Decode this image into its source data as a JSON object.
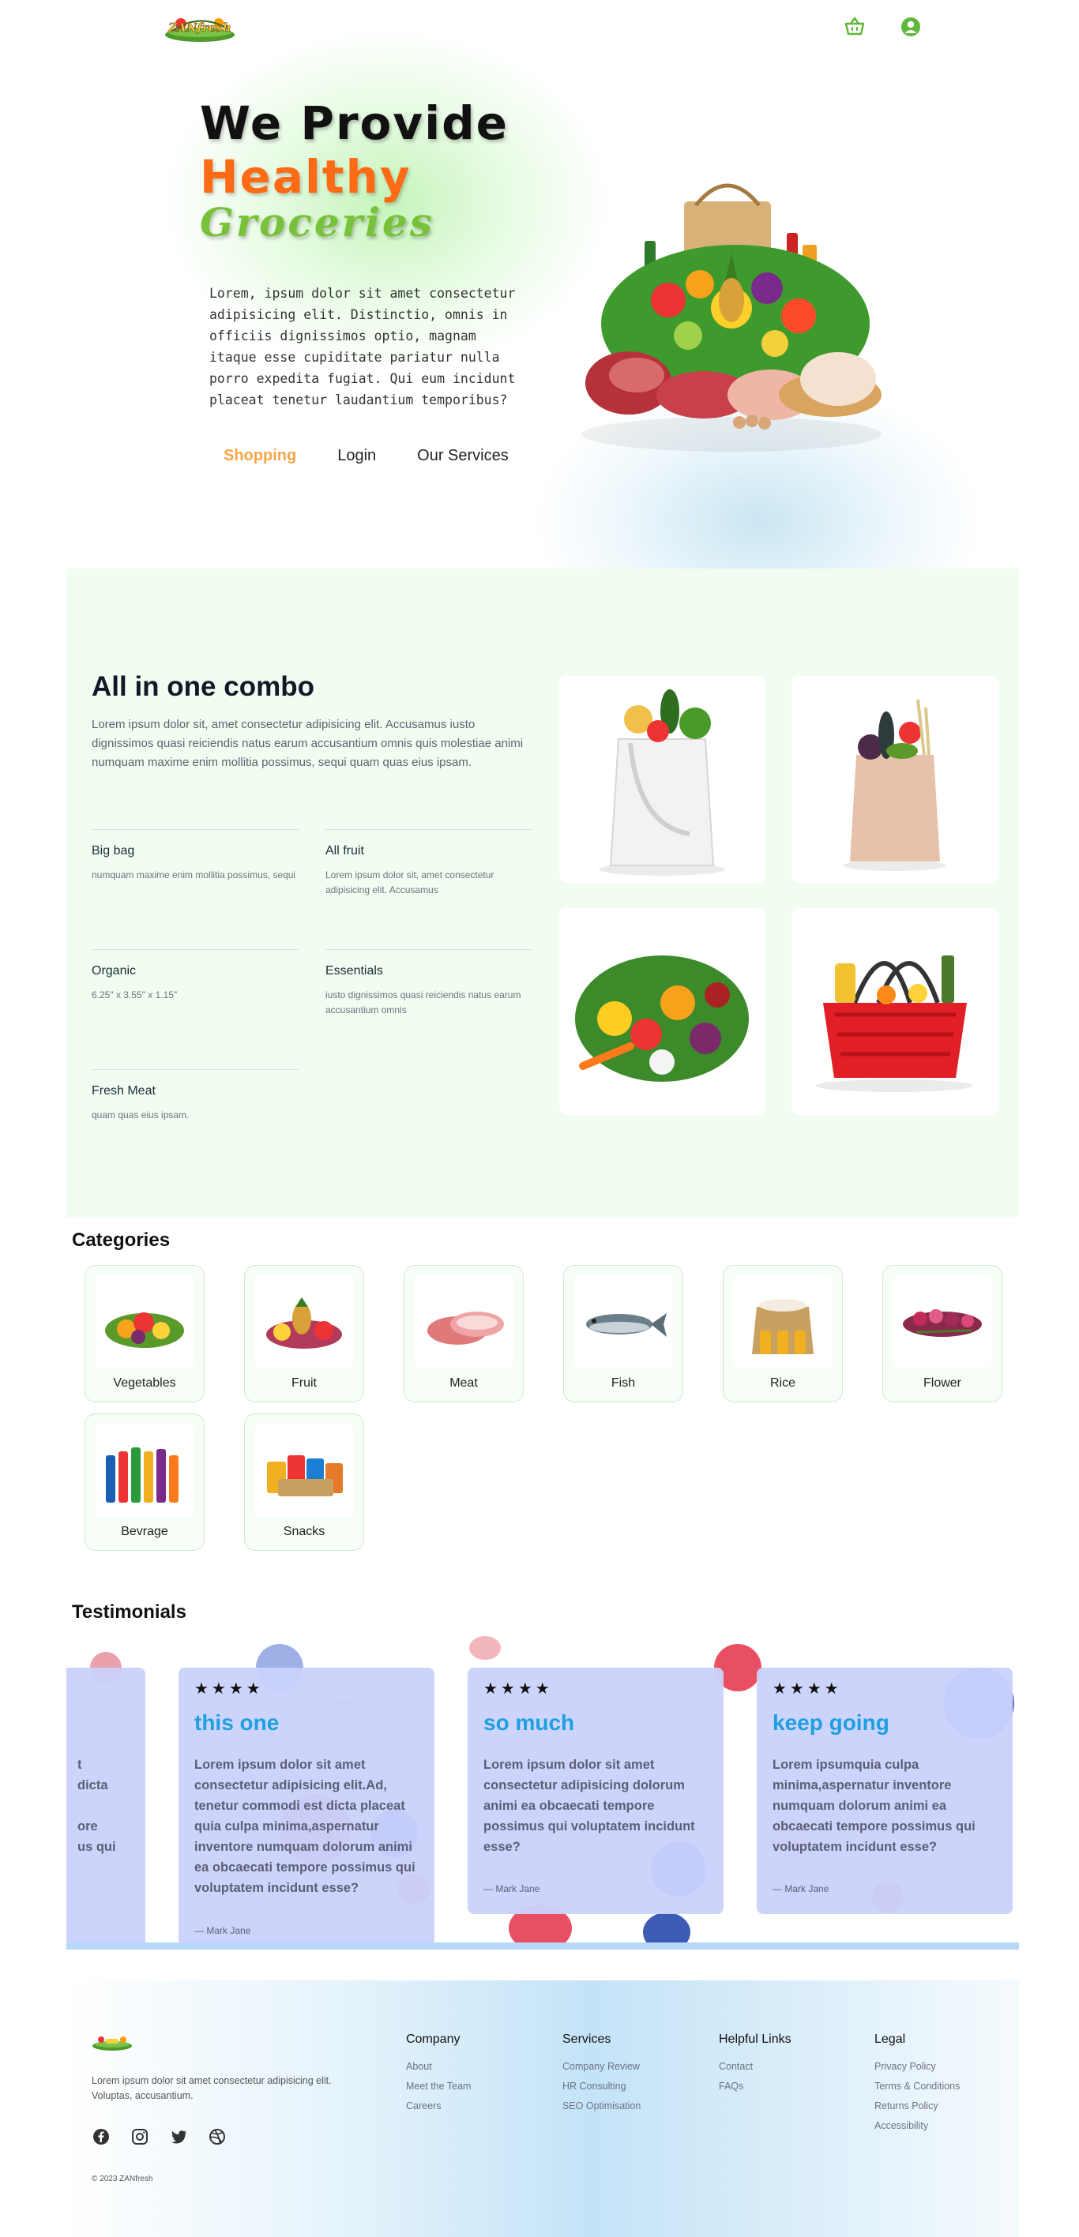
{
  "header": {
    "logo_text": "ZANfresh",
    "cart_icon": "basket-icon",
    "user_icon": "user-circle-icon",
    "accent_color": "#5fb83a"
  },
  "hero": {
    "line1": "We Provide",
    "line2": "Healthy",
    "line3": "Groceries",
    "text": "Lorem, ipsum dolor sit amet consectetur adipisicing elit. Distinctio, omnis in officiis dignissimos optio, magnam itaque esse cupiditate pariatur nulla porro expedita fugiat. Qui eum incidunt placeat tenetur laudantium temporibus?",
    "nav": [
      "Shopping",
      "Login",
      "Our Services"
    ],
    "colors": {
      "healthy": "#ff6a14",
      "groceries": "#78c23a",
      "active_nav": "#f5a64a"
    }
  },
  "combo": {
    "title": "All in one combo",
    "description": "Lorem ipsum dolor sit, amet consectetur adipisicing elit. Accusamus iusto dignissimos quasi reiciendis natus earum accusantium omnis quis molestiae animi numquam maxime enim mollitia possimus, sequi quam quas eius ipsam.",
    "features": [
      {
        "name": "Big bag",
        "text": "numquam maxime enim mollitia possimus, sequi"
      },
      {
        "name": "All fruit",
        "text": "Lorem ipsum dolor sit, amet consectetur adipisicing elit. Accusamus"
      },
      {
        "name": "Organic",
        "text": "6.25\" x 3.55\" x 1.15\""
      },
      {
        "name": "Essentials",
        "text": "iusto dignissimos quasi reiciendis natus earum accusantium omnis"
      },
      {
        "name": "Fresh Meat",
        "text": "quam quas eius ipsam."
      }
    ],
    "images": [
      "white-tote-bag-groceries",
      "paper-bag-vegetables",
      "vegetable-pile",
      "red-basket-groceries"
    ]
  },
  "categories": {
    "title": "Categories",
    "items": [
      "Vegetables",
      "Fruit",
      "Meat",
      "Fish",
      "Rice",
      "Flower",
      "Bevrage",
      "Snacks"
    ]
  },
  "testimonials": {
    "title": "Testimonials",
    "partial_card_lines": [
      "t",
      "dicta",
      "ore",
      "us qui"
    ],
    "cards": [
      {
        "stars": "★★★★",
        "title": "this one",
        "body": "Lorem ipsum dolor sit amet consectetur adipisicing elit.Ad, tenetur commodi est dicta placeat quia culpa minima,aspernatur inventore numquam dolorum animi ea obcaecati tempore possimus qui voluptatem incidunt esse?",
        "author": "— Mark Jane"
      },
      {
        "stars": "★★★★",
        "title": "so much",
        "body": "Lorem ipsum dolor sit amet consectetur adipisicing dolorum animi ea obcaecati tempore possimus qui voluptatem incidunt esse?",
        "author": "— Mark Jane"
      },
      {
        "stars": "★★★★",
        "title": "keep going",
        "body": "Lorem ipsumquia culpa minima,aspernatur inventore numquam dolorum animi ea obcaecati tempore possimus qui voluptatem incidunt esse?",
        "author": "— Mark Jane"
      }
    ],
    "title_color": "#1d9fe0",
    "card_color": "#cad2fc"
  },
  "footer": {
    "description": "Lorem ipsum dolor sit amet consectetur adipisicing elit. Voluptas, accusantium.",
    "social_icons": [
      "facebook-icon",
      "instagram-icon",
      "twitter-icon",
      "dribbble-icon"
    ],
    "copyright": "© 2023 ZANfresh",
    "columns": [
      {
        "title": "Company",
        "links": [
          "About",
          "Meet the Team",
          "Careers"
        ]
      },
      {
        "title": "Services",
        "links": [
          "Company Review",
          "HR Consulting",
          "SEO Optimisation"
        ]
      },
      {
        "title": "Helpful Links",
        "links": [
          "Contact",
          "FAQs"
        ]
      },
      {
        "title": "Legal",
        "links": [
          "Privacy Policy",
          "Terms & Conditions",
          "Returns Policy",
          "Accessibility"
        ]
      }
    ]
  }
}
